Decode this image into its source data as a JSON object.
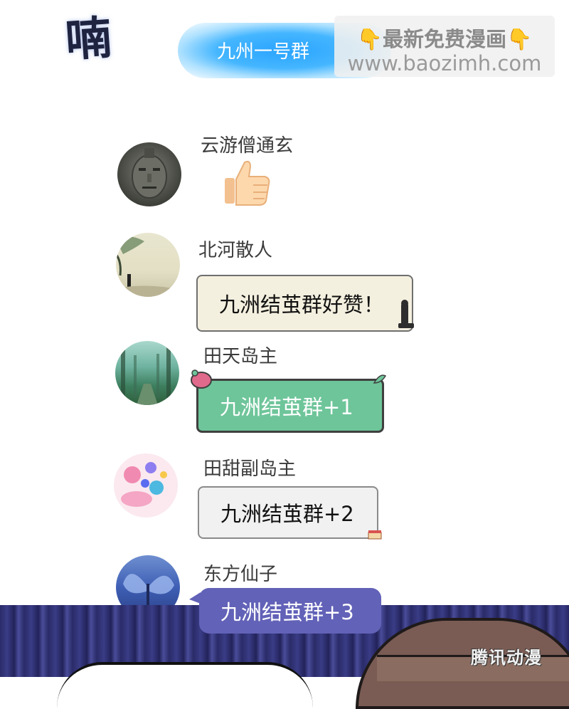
{
  "sfx_text": "喃",
  "header": {
    "title": "九州一号群"
  },
  "watermark": {
    "line1": "最新免费漫画",
    "line2": "www.baozimh.com",
    "emoji": "👇"
  },
  "messages": [
    {
      "name": "云游僧通玄",
      "type": "emoji",
      "content": "👍"
    },
    {
      "name": "北河散人",
      "type": "text",
      "content": "九洲结茧群好赞！"
    },
    {
      "name": "田天岛主",
      "type": "text",
      "content": "九洲结茧群+1"
    },
    {
      "name": "田甜副岛主",
      "type": "text",
      "content": "九洲结茧群+2"
    },
    {
      "name": "东方仙子",
      "type": "text",
      "content": "九洲结茧群+3"
    }
  ],
  "logo": "腾讯动漫",
  "colors": {
    "header_glow": "#2aa4ff",
    "bubble_green": "#6ec59a",
    "bubble_purple": "#6262b8",
    "bubble_beige": "#f4f0df",
    "bubble_gray": "#f1f1f1"
  },
  "icons": {
    "thumb": "thumbs-up-emoji",
    "watermark": "pointing-down-hand-icon"
  }
}
